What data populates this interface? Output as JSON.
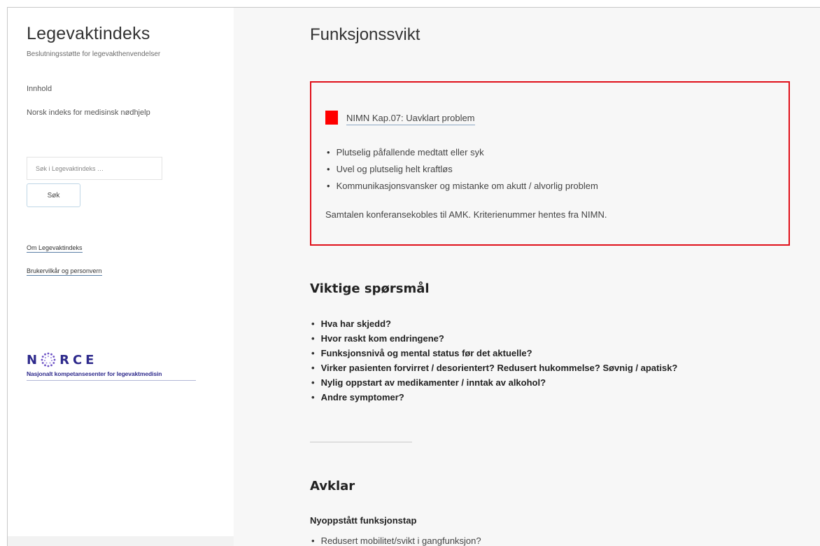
{
  "sidebar": {
    "site_title": "Legevaktindeks",
    "site_description": "Beslutningsstøtte for legevakthenvendelser",
    "nav": [
      {
        "label": "Innhold"
      },
      {
        "label": "Norsk indeks for medisinsk nødhjelp"
      }
    ],
    "search": {
      "placeholder": "Søk i Legevaktindeks …",
      "button_label": "Søk"
    },
    "links": [
      {
        "label": "Om Legevaktindeks"
      },
      {
        "label": "Brukervilkår og personvern"
      }
    ],
    "logo": {
      "word_prefix": "N",
      "word_suffix": "RCE",
      "subtitle": "Nasjonalt kompetansesenter for legevaktmedisin",
      "color": "#2e2a8c"
    }
  },
  "main": {
    "title": "Funksjonssvikt",
    "alert": {
      "border_color": "#e0101a",
      "flag_color": "#ff0000",
      "link_label": "NIMN Kap.07: Uavklart problem",
      "items": [
        "Plutselig påfallende medtatt eller syk",
        "Uvel og plutselig helt kraftløs",
        "Kommunikasjonsvansker og mistanke om akutt / alvorlig problem"
      ],
      "note": "Samtalen konferansekobles til AMK. Kriterienummer hentes fra NIMN."
    },
    "questions_heading": "Viktige spørsmål",
    "questions": [
      "Hva har skjedd?",
      "Hvor raskt kom endringene?",
      "Funksjonsnivå og mental status før det aktuelle?",
      "Virker pasienten forvirret / desorientert? Redusert hukommelse? Søvnig / apatisk?",
      "Nylig oppstart av medikamenter / inntak av alkohol?",
      "Andre symptomer?"
    ],
    "clarify_heading": "Avklar",
    "clarify_subheading": "Nyoppstått funksjonstap",
    "clarify_items": [
      "Redusert mobilitet/svikt i gangfunksjon?"
    ]
  }
}
